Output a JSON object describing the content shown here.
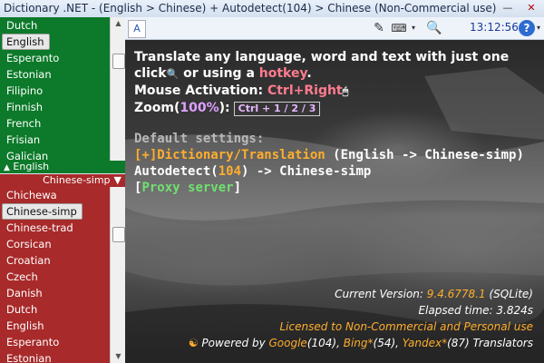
{
  "window": {
    "title": "Dictionary .NET - (English > Chinese) + Autodetect(104) > Chinese (Non-Commercial use)",
    "minimize_glyph": "—",
    "close_glyph": "✕"
  },
  "source_list": {
    "items": [
      "Dutch",
      "English",
      "Esperanto",
      "Estonian",
      "Filipino",
      "Finnish",
      "French",
      "Frisian",
      "Galician"
    ],
    "selected": "English"
  },
  "direction": {
    "source_label": "English",
    "source_glyph": "▲",
    "target_label": "Chinese-simp",
    "target_glyph": "▼"
  },
  "target_list": {
    "items": [
      "Chichewa",
      "Chinese-simp",
      "Chinese-trad",
      "Corsican",
      "Croatian",
      "Czech",
      "Danish",
      "Dutch",
      "English",
      "Esperanto",
      "Estonian"
    ],
    "selected": "Chinese-simp"
  },
  "scrollbar_glyphs": {
    "up": "▲",
    "down": "▼"
  },
  "toolbar": {
    "logo_glyph": "A",
    "pencil_icon": "✎",
    "keyboard_icon": "⌨",
    "dropdown_glyph": "▾",
    "search_icon": "🔍",
    "clock": "13:12:56",
    "help_icon": "?"
  },
  "intro": {
    "line1": "Translate any language, word and text with just one",
    "line2_pre": "click",
    "line2_icon": "🔍",
    "line2_mid": " or using a ",
    "line2_hotkey": "hotkey",
    "line2_post": ".",
    "mouse_label": "Mouse Activation: ",
    "mouse_value": "Ctrl+Right",
    "mouse_icon": "🖱",
    "zoom_label": "Zoom(",
    "zoom_value": "100%",
    "zoom_close": "):",
    "zoom_keys": "Ctrl + 1 / 2 / 3"
  },
  "defaults": {
    "heading": "Default settings:",
    "dict_prefix": "[+]",
    "dict_label": "Dictionary/Translation",
    "dict_value": " (English -> Chinese-simp)",
    "auto_label": "Autodetect(",
    "auto_count": "104",
    "auto_value": ") -> Chinese-simp",
    "proxy_open": "[",
    "proxy_label": "Proxy server",
    "proxy_close": "]"
  },
  "info": {
    "version_label": "Current Version: ",
    "version_value": "9.4.6778.1",
    "version_suffix": " (SQLite)",
    "elapsed": "Elapsed time: 3.824s",
    "license": "Licensed to Non-Commercial and Personal use",
    "powered_icon": "☯",
    "powered_pre": " Powered by ",
    "google": "Google",
    "google_count": "(104), ",
    "bing": "Bing*",
    "bing_count": "(54), ",
    "yandex": "Yandex*",
    "yandex_count": "(87) Translators"
  },
  "colors": {
    "source_list_bg": "#0c7a2a",
    "target_list_bg": "#a82a2a",
    "hotkey": "#ff7c8f",
    "accent": "#ffae2d",
    "proxy": "#6fe06f"
  }
}
